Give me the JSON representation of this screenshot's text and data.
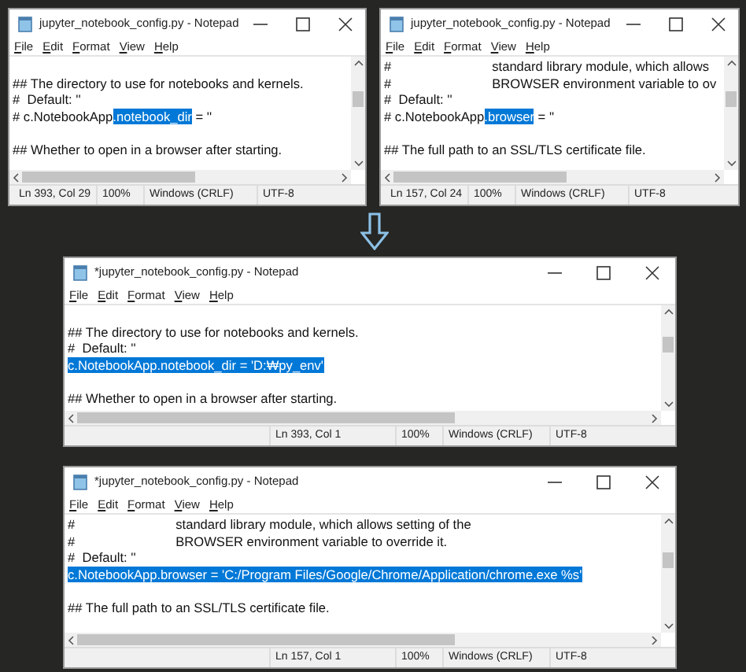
{
  "windows": [
    {
      "title": "jupyter_notebook_config.py - Notepad",
      "menu": [
        "File",
        "Edit",
        "Format",
        "View",
        "Help"
      ],
      "lines": [
        {
          "kind": "blank"
        },
        {
          "kind": "text",
          "parts": [
            {
              "text": "## The directory to use for notebooks and kernels.",
              "selected": false
            }
          ]
        },
        {
          "kind": "text",
          "parts": [
            {
              "text": "#  Default: ''",
              "selected": false
            }
          ]
        },
        {
          "kind": "text",
          "parts": [
            {
              "text": "# c.NotebookApp",
              "selected": false
            },
            {
              "text": ".notebook_dir",
              "selected": true
            },
            {
              "text": " = ''",
              "selected": false
            }
          ]
        },
        {
          "kind": "blank"
        },
        {
          "kind": "text",
          "parts": [
            {
              "text": "## Whether to open in a browser after starting.",
              "selected": false
            }
          ]
        }
      ],
      "status": [
        "Ln 393, Col 29",
        "100%",
        "Windows (CRLF)",
        "UTF-8"
      ]
    },
    {
      "title": "jupyter_notebook_config.py - Notepad",
      "menu": [
        "File",
        "Edit",
        "Format",
        "View",
        "Help"
      ],
      "lines": [
        {
          "kind": "text",
          "parts": [
            {
              "text": "#",
              "selected": false
            },
            {
              "text": "standard library module, which allows",
              "selected": false,
              "tab": true
            }
          ]
        },
        {
          "kind": "text",
          "parts": [
            {
              "text": "#",
              "selected": false
            },
            {
              "text": "BROWSER environment variable to ov",
              "selected": false,
              "tab": true
            }
          ]
        },
        {
          "kind": "text",
          "parts": [
            {
              "text": "#  Default: ''",
              "selected": false
            }
          ]
        },
        {
          "kind": "text",
          "parts": [
            {
              "text": "# c.NotebookApp",
              "selected": false
            },
            {
              "text": ".browser",
              "selected": true
            },
            {
              "text": " = ''",
              "selected": false
            }
          ]
        },
        {
          "kind": "blank"
        },
        {
          "kind": "text",
          "parts": [
            {
              "text": "## The full path to an SSL/TLS certificate file.",
              "selected": false
            }
          ]
        }
      ],
      "status": [
        "Ln 157, Col 24",
        "100%",
        "Windows (CRLF)",
        "UTF-8"
      ]
    },
    {
      "title": "*jupyter_notebook_config.py - Notepad",
      "menu": [
        "File",
        "Edit",
        "Format",
        "View",
        "Help"
      ],
      "lines": [
        {
          "kind": "blank"
        },
        {
          "kind": "text",
          "parts": [
            {
              "text": "## The directory to use for notebooks and kernels.",
              "selected": false
            }
          ]
        },
        {
          "kind": "text",
          "parts": [
            {
              "text": "#  Default: ''",
              "selected": false
            }
          ]
        },
        {
          "kind": "text",
          "parts": [
            {
              "text": "c.NotebookApp.notebook_dir = 'D:₩py_env'",
              "selected": true
            }
          ]
        },
        {
          "kind": "blank"
        },
        {
          "kind": "text",
          "parts": [
            {
              "text": "## Whether to open in a browser after starting.",
              "selected": false
            }
          ]
        }
      ],
      "status": [
        "Ln 393, Col 1",
        "100%",
        "Windows (CRLF)",
        "UTF-8"
      ]
    },
    {
      "title": "*jupyter_notebook_config.py - Notepad",
      "menu": [
        "File",
        "Edit",
        "Format",
        "View",
        "Help"
      ],
      "lines": [
        {
          "kind": "text",
          "parts": [
            {
              "text": "#",
              "selected": false
            },
            {
              "text": "standard library module, which allows setting of the",
              "selected": false,
              "tab": true
            }
          ]
        },
        {
          "kind": "text",
          "parts": [
            {
              "text": "#",
              "selected": false
            },
            {
              "text": "BROWSER environment variable to override it.",
              "selected": false,
              "tab": true
            }
          ]
        },
        {
          "kind": "text",
          "parts": [
            {
              "text": "#  Default: ''",
              "selected": false
            }
          ]
        },
        {
          "kind": "text",
          "parts": [
            {
              "text": "c.NotebookApp.browser = 'C:/Program Files/Google/Chrome/Application/chrome.exe %s'",
              "selected": true
            }
          ]
        },
        {
          "kind": "blank"
        },
        {
          "kind": "text",
          "parts": [
            {
              "text": "## The full path to an SSL/TLS certificate file.",
              "selected": false
            }
          ]
        }
      ],
      "status": [
        "Ln 157, Col 1",
        "100%",
        "Windows (CRLF)",
        "UTF-8"
      ]
    }
  ]
}
